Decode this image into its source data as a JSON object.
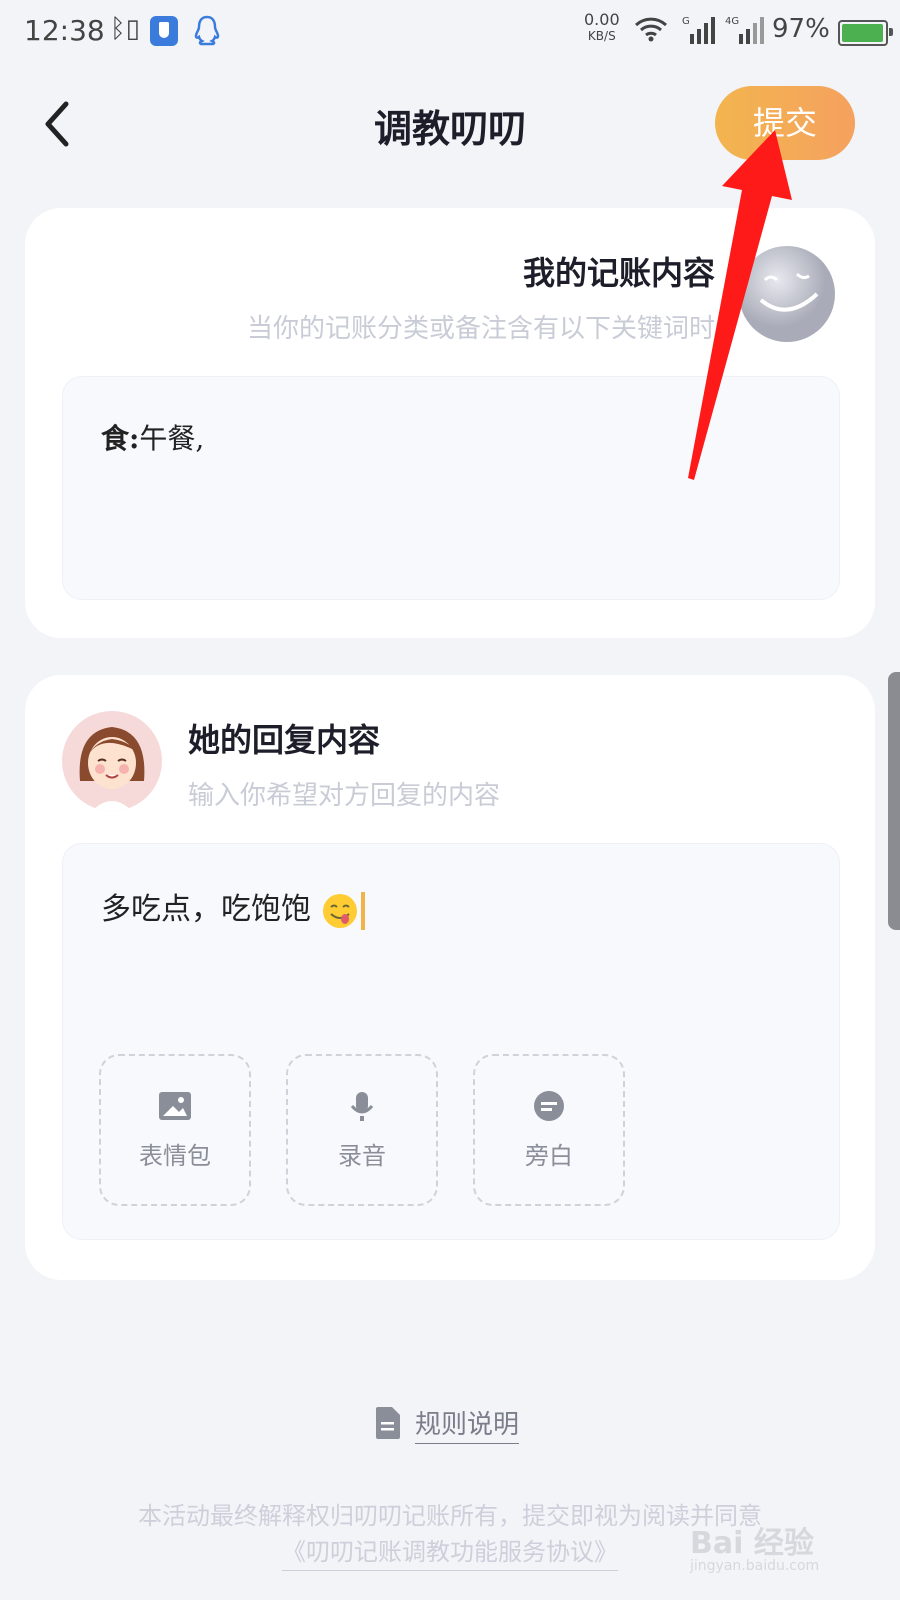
{
  "status_bar": {
    "time": "12:38",
    "net_speed_value": "0.00",
    "net_speed_unit": "KB/S",
    "signal1_label": "G",
    "signal2_label": "4G",
    "battery": "97%",
    "battery_level": 0.97
  },
  "header": {
    "title": "调教叨叨",
    "submit_label": "提交"
  },
  "my_card": {
    "title": "我的记账内容",
    "subtitle": "当你的记账分类或备注含有以下关键词时",
    "category": "食:",
    "keywords": "午餐,"
  },
  "her_card": {
    "title": "她的回复内容",
    "subtitle": "输入你希望对方回复的内容",
    "reply_text": "多吃点，吃饱饱",
    "tools": [
      {
        "label": "表情包",
        "icon": "image-icon"
      },
      {
        "label": "录音",
        "icon": "microphone-icon"
      },
      {
        "label": "旁白",
        "icon": "narration-icon"
      }
    ]
  },
  "rules_link": "规则说明",
  "footer": {
    "line1": "本活动最终解释权归叨叨记账所有，提交即视为阅读并同意",
    "agreement_link": "《叨叨记账调教功能服务协议》"
  },
  "watermark": {
    "main": "Bai 经验",
    "sub": "jingyan.baidu.com"
  },
  "colors": {
    "accent_gradient_start": "#f3b54f",
    "accent_gradient_end": "#f4a15e",
    "background": "#f3f4f8",
    "arrow": "#ff1a1a"
  }
}
